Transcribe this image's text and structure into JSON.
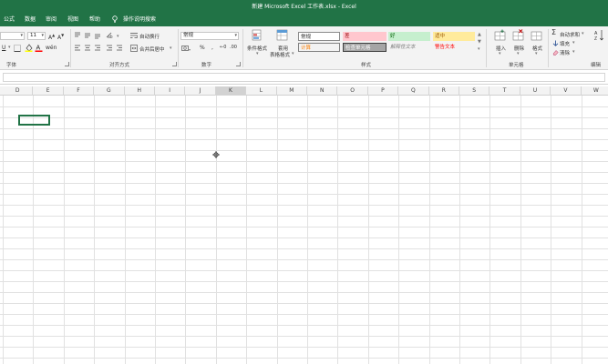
{
  "window": {
    "title": "新建 Microsoft Excel 工作表.xlsx  -  Excel"
  },
  "menu": {
    "tabs": [
      "公式",
      "数据",
      "审阅",
      "视图",
      "帮助"
    ],
    "tell_me": "操作说明搜索"
  },
  "ribbon": {
    "font": {
      "size": "11",
      "group_label": "字体"
    },
    "alignment": {
      "wrap_text": "自动换行",
      "merge_center": "合并后居中",
      "group_label": "对齐方式"
    },
    "number": {
      "format": "常规",
      "percent": "%",
      "comma": ",",
      "group_label": "数字"
    },
    "styles": {
      "conditional": "条件格式",
      "table_format_line1": "套用",
      "table_format_line2": "表格格式",
      "cells": [
        {
          "label": "常规",
          "bg": "#ffffff",
          "fg": "#222222"
        },
        {
          "label": "差",
          "bg": "#ffc7ce",
          "fg": "#9c0006"
        },
        {
          "label": "好",
          "bg": "#c6efce",
          "fg": "#006100"
        },
        {
          "label": "适中",
          "bg": "#ffeb9c",
          "fg": "#9c5700"
        },
        {
          "label": "计算",
          "bg": "#f2f2f2",
          "fg": "#fa7d00"
        },
        {
          "label": "检查单元格",
          "bg": "#a5a5a5",
          "fg": "#ffffff"
        },
        {
          "label": "解释性文本",
          "bg": "#f3f3f3",
          "fg": "#7f7f7f"
        },
        {
          "label": "警告文本",
          "bg": "#f3f3f3",
          "fg": "#ff0000"
        }
      ],
      "group_label": "样式"
    },
    "cells": {
      "insert": "插入",
      "delete": "删除",
      "format": "格式",
      "group_label": "单元格"
    },
    "editing": {
      "autosum": "自动求和",
      "fill": "填充",
      "clear": "清除",
      "group_label": "编辑"
    }
  },
  "sheet": {
    "columns": [
      "D",
      "E",
      "F",
      "G",
      "H",
      "I",
      "J",
      "K",
      "L",
      "M",
      "N",
      "O",
      "P",
      "Q",
      "R",
      "S",
      "T",
      "U",
      "V",
      "W"
    ],
    "selected_column": "K"
  },
  "colors": {
    "accent": "#217346",
    "grid_line": "#e1e1e1"
  }
}
